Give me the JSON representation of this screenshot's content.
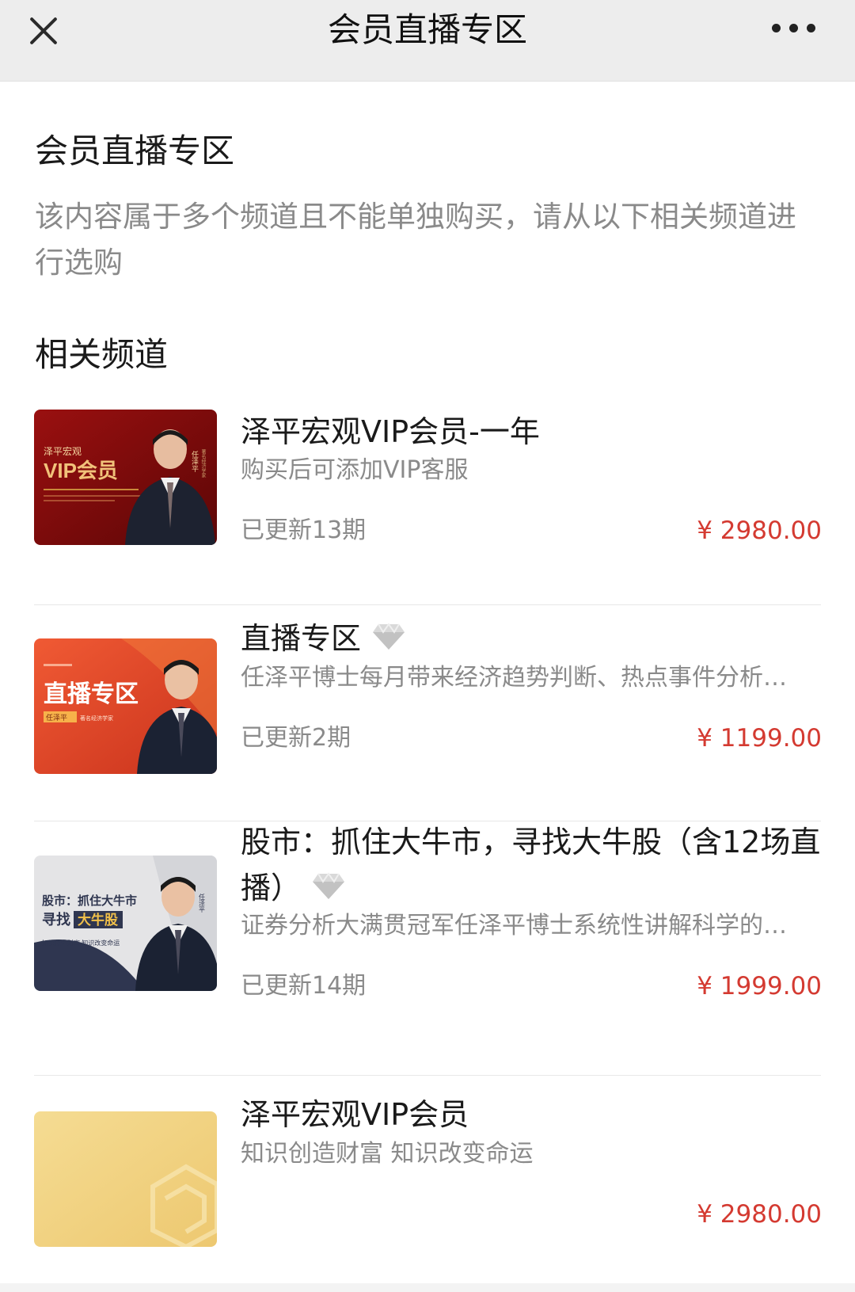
{
  "topbar": {
    "title": "会员直播专区"
  },
  "page": {
    "heading": "会员直播专区",
    "description": "该内容属于多个频道且不能单独购买，请从以下相关频道进行选购",
    "section_title": "相关频道"
  },
  "items": [
    {
      "title": "泽平宏观VIP会员-一年",
      "subtitle": "购买后可添加VIP客服",
      "count": "已更新13期",
      "price": "¥ 2980.00",
      "thumb": {
        "line1": "泽平宏观",
        "line2": "VIP会员",
        "side": "任泽平",
        "side2": "著名经济学家"
      }
    },
    {
      "title": "直播专区",
      "subtitle": "任泽平博士每月带来经济趋势判断、热点事件分析…",
      "count": "已更新2期",
      "price": "¥ 1199.00",
      "diamond": "diamond-icon",
      "thumb": {
        "line1": "直播专区",
        "tag": "任泽平",
        "tag2": "著名经济学家"
      }
    },
    {
      "title": "股市：抓住大牛市，寻找大牛股（含12场直播）",
      "subtitle": "证券分析大满贯冠军任泽平博士系统性讲解科学的…",
      "count": "已更新14期",
      "price": "¥ 1999.00",
      "diamond": "diamond-icon",
      "thumb": {
        "line1": "股市：抓住大牛市",
        "line2a": "寻找",
        "line2b": "大牛股",
        "line3": "知识创造财富  知识改变命运",
        "side": "任泽平"
      }
    },
    {
      "title": "泽平宏观VIP会员",
      "subtitle": "知识创造财富 知识改变命运",
      "count": "",
      "price": "¥ 2980.00"
    }
  ],
  "colors": {
    "price": "#d43a31",
    "muted": "#8a8a8a",
    "topbar_bg": "#ededed"
  }
}
